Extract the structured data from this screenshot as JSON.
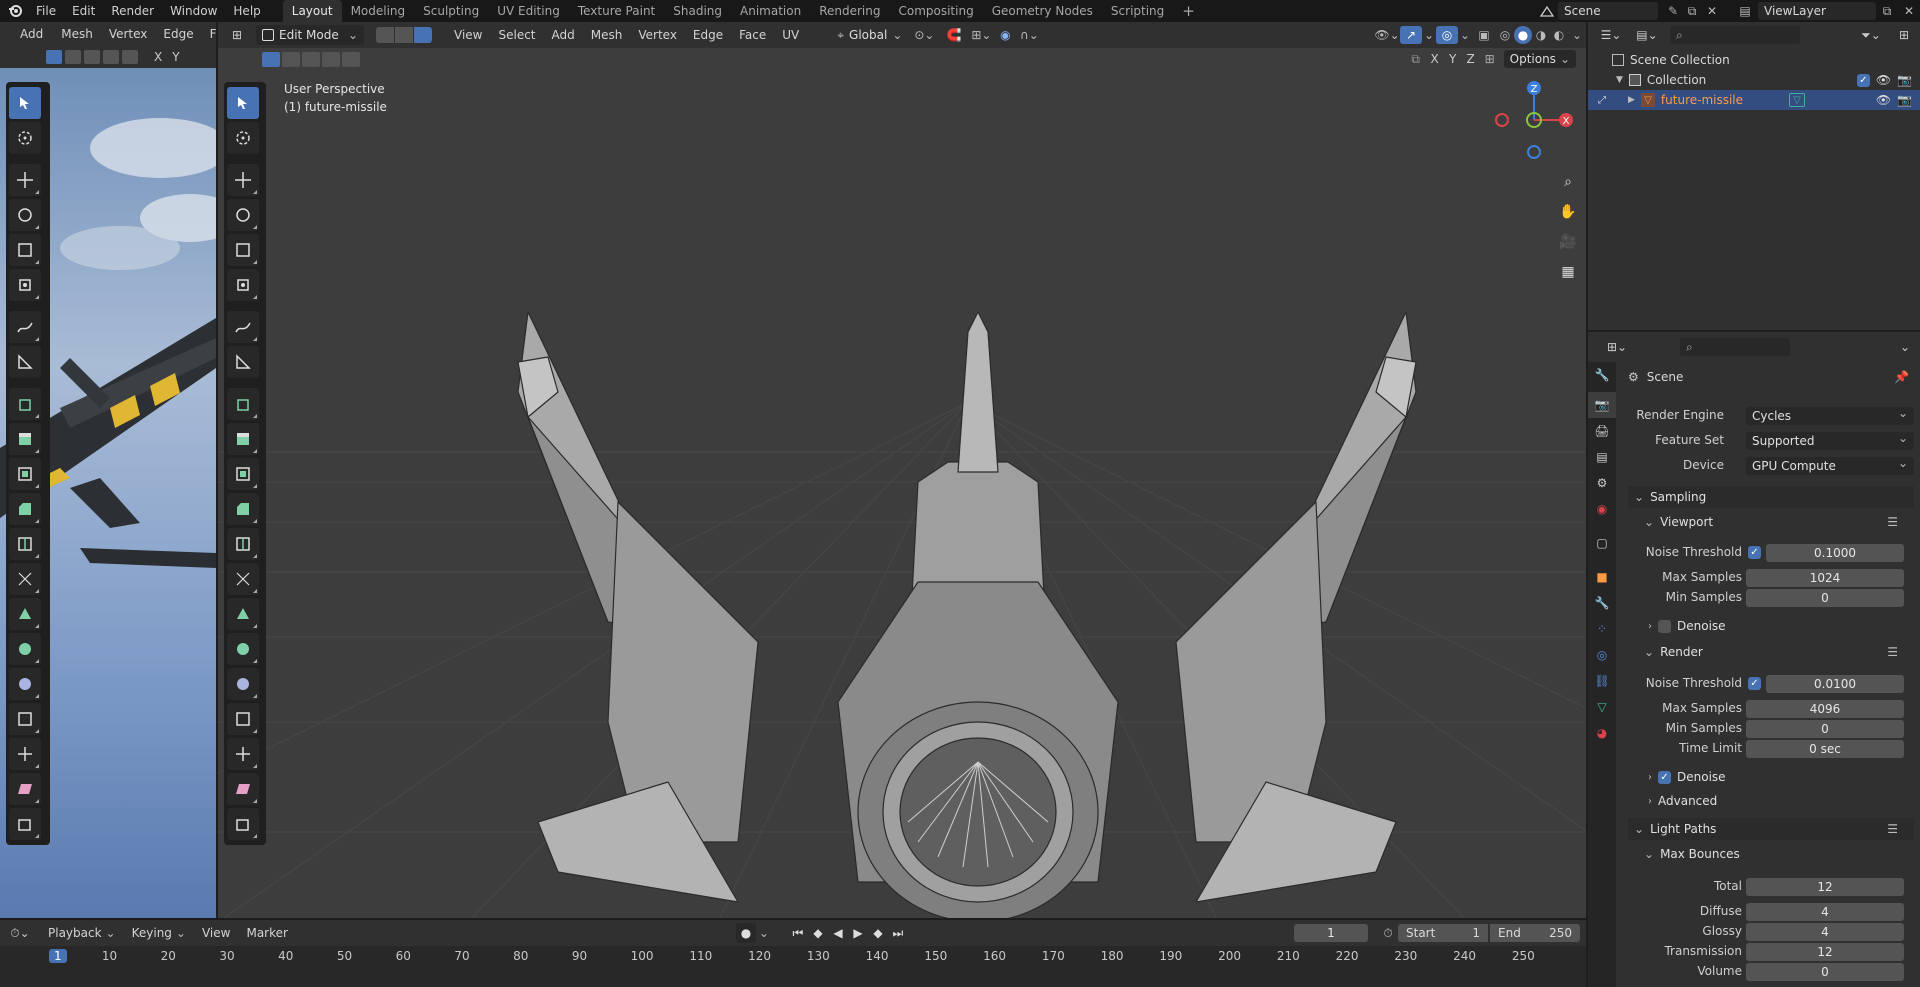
{
  "topbar": {
    "menus": [
      "File",
      "Edit",
      "Render",
      "Window",
      "Help"
    ],
    "workspaces": [
      "Layout",
      "Modeling",
      "Sculpting",
      "UV Editing",
      "Texture Paint",
      "Shading",
      "Animation",
      "Rendering",
      "Compositing",
      "Geometry Nodes",
      "Scripting"
    ],
    "active_workspace": "Layout",
    "scene": "Scene",
    "view_layer": "ViewLayer"
  },
  "left_view": {
    "menus": [
      "Add",
      "Mesh",
      "Vertex",
      "Edge",
      "Face"
    ],
    "axes": [
      "X",
      "Y"
    ]
  },
  "viewport": {
    "mode": "Edit Mode",
    "menus": [
      "View",
      "Select",
      "Add",
      "Mesh",
      "Vertex",
      "Edge",
      "Face",
      "UV"
    ],
    "orientation": "Global",
    "axes": [
      "X",
      "Y",
      "Z"
    ],
    "options_label": "Options",
    "overlay_line1": "User Perspective",
    "overlay_line2": "(1) future-missile",
    "gizmo": {
      "z": "Z",
      "x": "X",
      "y": "Y"
    }
  },
  "outliner": {
    "scene_collection": "Scene Collection",
    "collection": "Collection",
    "object": "future-missile"
  },
  "properties": {
    "scene_label": "Scene",
    "render_engine_label": "Render Engine",
    "render_engine": "Cycles",
    "feature_set_label": "Feature Set",
    "feature_set": "Supported",
    "device_label": "Device",
    "device": "GPU Compute",
    "sampling": "Sampling",
    "viewport": "Viewport",
    "noise_threshold_label": "Noise Threshold",
    "viewport_noise_threshold": "0.1000",
    "max_samples_label": "Max Samples",
    "viewport_max_samples": "1024",
    "min_samples_label": "Min Samples",
    "viewport_min_samples": "0",
    "denoise_label": "Denoise",
    "render": "Render",
    "render_noise_threshold": "0.0100",
    "render_max_samples": "4096",
    "render_min_samples": "0",
    "time_limit_label": "Time Limit",
    "time_limit": "0 sec",
    "advanced": "Advanced",
    "light_paths": "Light Paths",
    "max_bounces": "Max Bounces",
    "total_label": "Total",
    "total": "12",
    "diffuse_label": "Diffuse",
    "diffuse": "4",
    "glossy_label": "Glossy",
    "glossy": "4",
    "transmission_label": "Transmission",
    "transmission": "12",
    "volume_label": "Volume",
    "volume": "0"
  },
  "timeline": {
    "menus": [
      "Playback",
      "Keying",
      "View",
      "Marker"
    ],
    "current_frame": "1",
    "start_label": "Start",
    "start": "1",
    "end_label": "End",
    "end": "250",
    "ticks": [
      "1",
      "10",
      "20",
      "30",
      "40",
      "50",
      "60",
      "70",
      "80",
      "90",
      "100",
      "110",
      "120",
      "130",
      "140",
      "150",
      "160",
      "170",
      "180",
      "190",
      "200",
      "210",
      "220",
      "230",
      "240",
      "250"
    ]
  },
  "colors": {
    "accent": "#4772b3",
    "selected_row": "#334d80",
    "object_text": "#ff9a44"
  }
}
